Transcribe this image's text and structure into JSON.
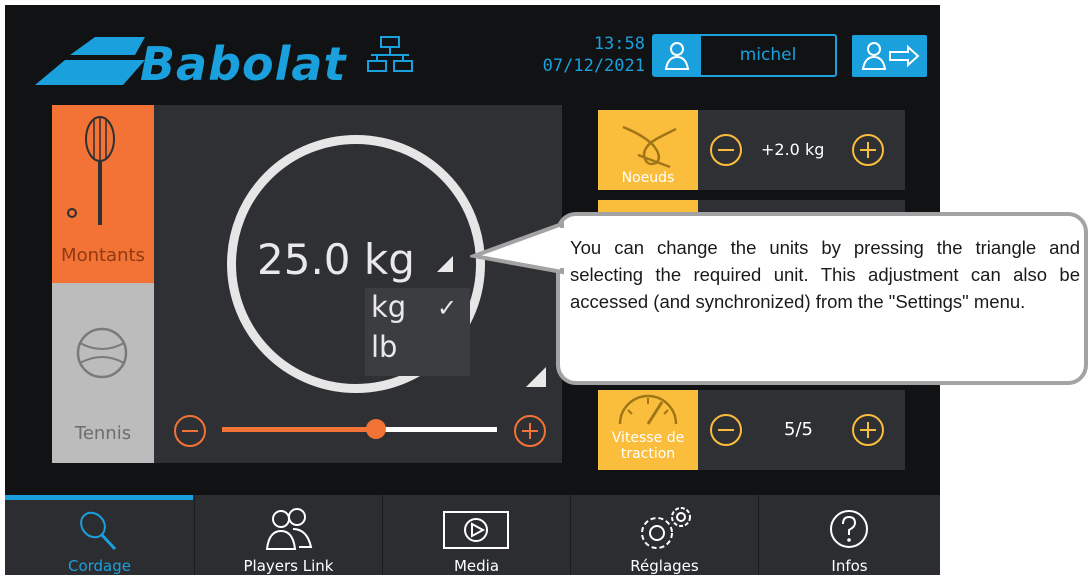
{
  "header": {
    "logo_text": "Babolat",
    "time": "13:58",
    "date": "07/12/2021",
    "user_name": "michel",
    "accent_color": "#1aa0dc"
  },
  "tabs": {
    "montants_label": "Montants",
    "tennis_label": "Tennis",
    "active": "Montants"
  },
  "tension": {
    "value": "25.0",
    "unit": "kg",
    "unit_options": [
      "kg",
      "lb"
    ],
    "selected_unit": "kg",
    "slider_level_percent": 56
  },
  "params": {
    "noeuds": {
      "label": "Noeuds",
      "value": "+2.0 kg"
    },
    "vitesse": {
      "label_line1": "Vitesse de",
      "label_line2": "traction",
      "value": "5/5"
    }
  },
  "tooltip": {
    "text": "You can change the units by pressing the triangle and selecting the required unit. This adjustment can also be accessed (and synchronized) from the \"Settings\" menu."
  },
  "nav": {
    "items": [
      "Cordage",
      "Players Link",
      "Media",
      "Réglages",
      "Infos"
    ],
    "active": "Cordage"
  },
  "colors": {
    "orange": "#f37336",
    "yellow": "#fbbd3c",
    "panel": "#2e3033",
    "background": "#111214"
  }
}
